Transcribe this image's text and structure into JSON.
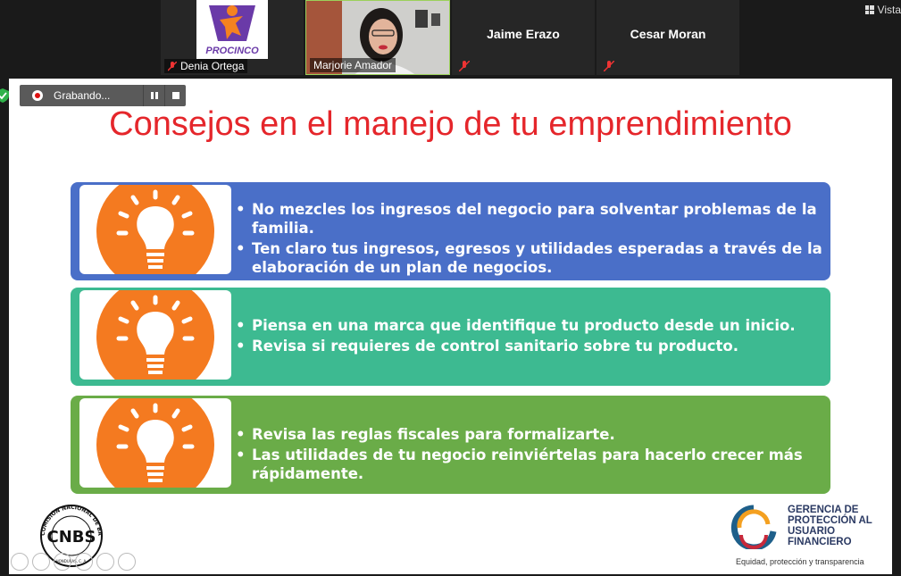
{
  "participants": [
    {
      "name": "Denia Ortega",
      "logo_text": "PROCINCO"
    },
    {
      "name": "Marjorie Amador"
    },
    {
      "name": "Jaime Erazo"
    },
    {
      "name": "Cesar Moran"
    }
  ],
  "view_button": "Vista",
  "recording": {
    "label": "Grabando..."
  },
  "slide": {
    "title": "Consejos en el manejo de tu emprendimiento",
    "panels": [
      {
        "color": "#4a6fc8",
        "items": [
          "No mezcles los ingresos del negocio para solventar problemas de la familia.",
          "Ten claro tus ingresos, egresos y utilidades esperadas a través de la elaboración de un plan de negocios."
        ]
      },
      {
        "color": "#3dba91",
        "items": [
          "Piensa en una marca que identifique tu producto desde un inicio.",
          "Revisa si requieres de control sanitario sobre tu producto."
        ]
      },
      {
        "color": "#6aac48",
        "items": [
          "Revisa las reglas fiscales para formalizarte.",
          "Las utilidades de tu negocio reinviértelas para hacerlo crecer más rápidamente."
        ]
      }
    ],
    "logo_left": {
      "text": "CNBS",
      "ring": "COMISIÓN NACIONAL DE BANCOS Y SEGUROS",
      "sub": "HONDURAS, C. A."
    },
    "logo_right": {
      "lines": [
        "GERENCIA DE",
        "PROTECCIÓN AL",
        "USUARIO",
        "FINANCIERO"
      ],
      "tagline": "Equidad, protección y transparencia"
    }
  },
  "colors": {
    "title": "#e5262b",
    "bulb_orange": "#f47a20"
  }
}
